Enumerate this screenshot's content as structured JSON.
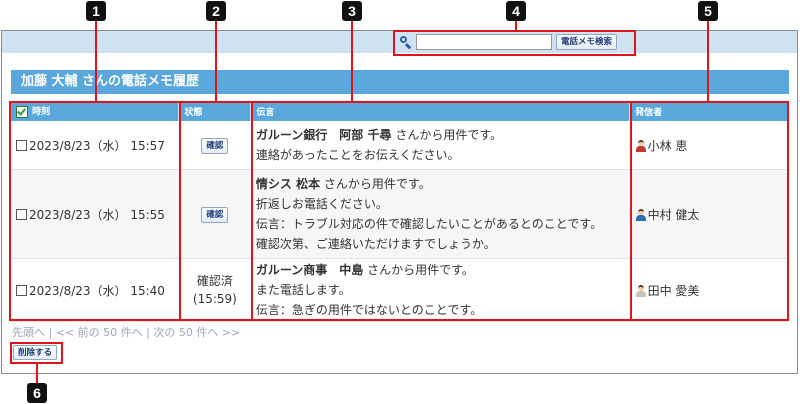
{
  "search": {
    "placeholder": "",
    "value": "",
    "button_label": "電話メモ検索"
  },
  "page_title": "加藤 大輔 さんの電話メモ履歴",
  "table": {
    "headers": {
      "time": "時刻",
      "status": "状態",
      "message": "伝言",
      "sender": "発信者"
    },
    "rows": [
      {
        "time": "2023/8/23（水） 15:57",
        "status_button": "確認",
        "message_name": "ガルーン銀行　阿部 千尋",
        "message_lines": [
          "さんから用件です。",
          "連絡があったことをお伝えください。"
        ],
        "sender": "小林 恵",
        "avatar_color": "#c0392b"
      },
      {
        "time": "2023/8/23（水） 15:55",
        "status_button": "確認",
        "message_name": "情シス 松本",
        "message_lines": [
          "さんから用件です。",
          "折返しお電話ください。",
          "伝言：トラブル対応の件で確認したいことがあるとのことです。",
          "確認次第、ご連絡いただけますでしょうか。"
        ],
        "sender": "中村 健太",
        "avatar_color": "#2f6fb5"
      },
      {
        "time": "2023/8/23（水） 15:40",
        "status_text": "確認済",
        "status_time": "(15:59)",
        "message_name": "ガルーン商事　中島",
        "message_lines": [
          "さんから用件です。",
          "また電話します。",
          "伝言：急ぎの用件ではないとのことです。"
        ],
        "sender": "田中 愛美",
        "avatar_color": "#c9c2ba"
      }
    ]
  },
  "pager": {
    "first": "先頭へ",
    "prev": "<< 前の 50 件へ",
    "next": "次の 50 件へ >>"
  },
  "delete_button": "削除する",
  "callouts": [
    "1",
    "2",
    "3",
    "4",
    "5",
    "6"
  ],
  "colors": {
    "accent": "#5aa7dc",
    "callout": "#e0141c",
    "topbar": "#cfe2f1"
  }
}
